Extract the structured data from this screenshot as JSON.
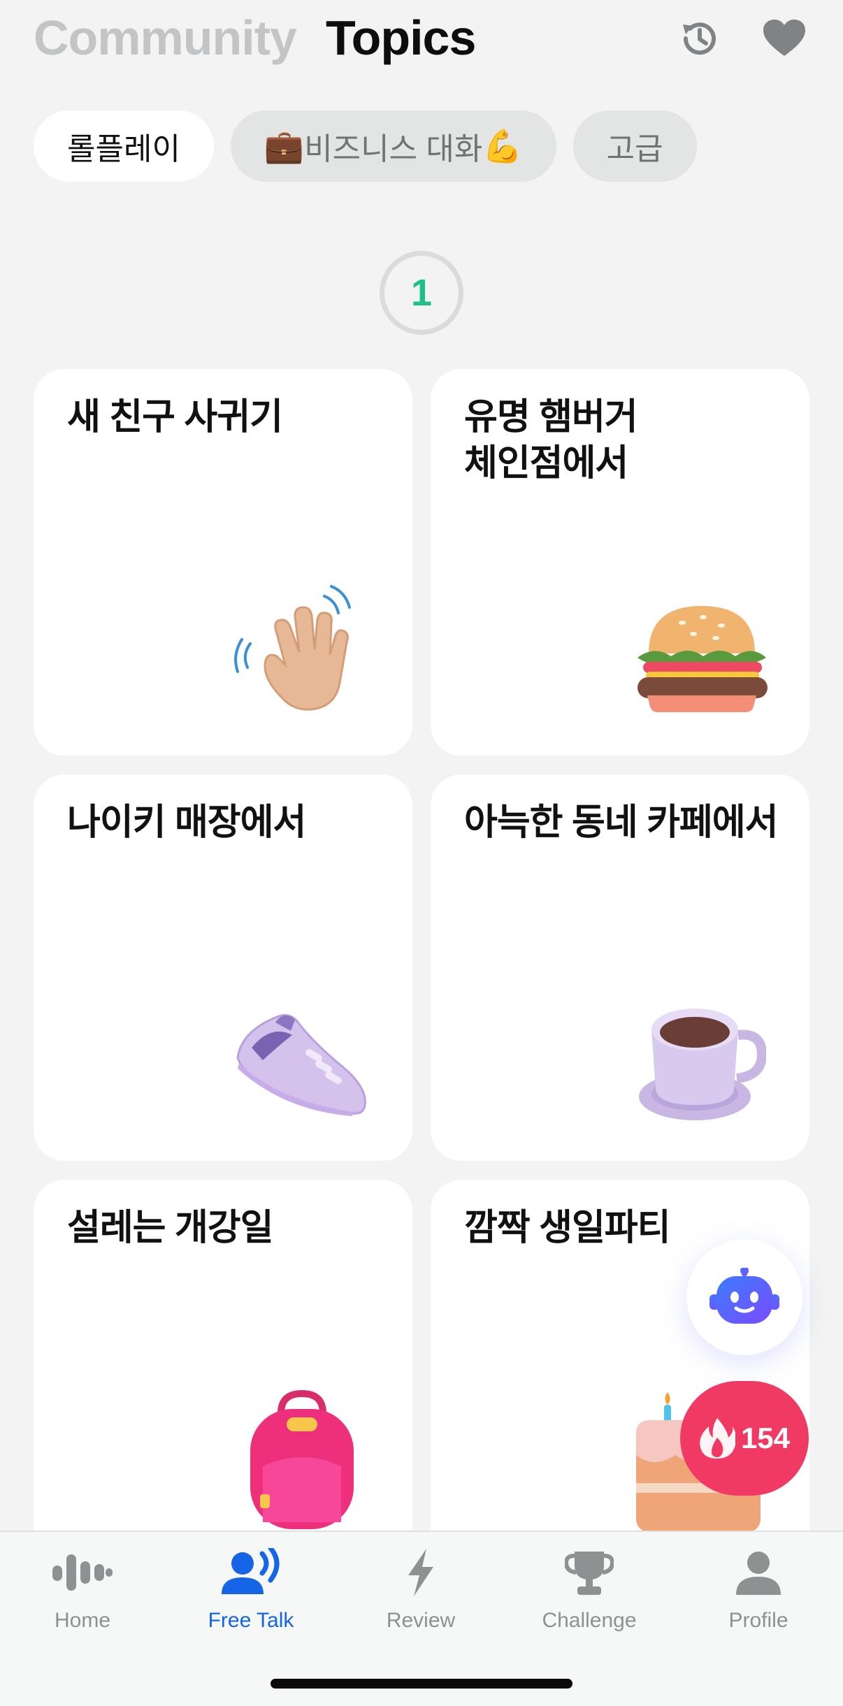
{
  "header": {
    "tabs": [
      {
        "label": "Community",
        "active": false
      },
      {
        "label": "Topics",
        "active": true
      }
    ],
    "icons": [
      "history-icon",
      "heart-icon"
    ]
  },
  "chips": [
    {
      "label": "롤플레이",
      "active": true
    },
    {
      "emoji_left": "💼",
      "label": "비즈니스 대화",
      "emoji_right": "💪",
      "active": false
    },
    {
      "label": "고급",
      "active": false
    }
  ],
  "step": {
    "number": "1",
    "color": "#1fbf89"
  },
  "cards": [
    {
      "title": "새 친구 사귀기",
      "icon": "waving-hand-icon"
    },
    {
      "title": "유명 햄버거\n체인점에서",
      "icon": "hamburger-icon"
    },
    {
      "title": "나이키 매장에서",
      "icon": "sneaker-icon"
    },
    {
      "title": "아늑한 동네 카페에서",
      "icon": "coffee-cup-icon"
    },
    {
      "title": "설레는 개강일",
      "icon": "backpack-icon"
    },
    {
      "title": "깜짝 생일파티",
      "icon": "birthday-cake-icon"
    }
  ],
  "fab": {
    "bot_icon": "robot-icon",
    "streak_count": "154",
    "streak_icon": "fire-icon",
    "streak_color": "#f13a63"
  },
  "tabbar": {
    "items": [
      {
        "label": "Home",
        "icon": "waveform-icon",
        "active": false
      },
      {
        "label": "Free Talk",
        "icon": "speaking-person-icon",
        "active": true
      },
      {
        "label": "Review",
        "icon": "lightning-icon",
        "active": false
      },
      {
        "label": "Challenge",
        "icon": "trophy-icon",
        "active": false
      },
      {
        "label": "Profile",
        "icon": "person-icon",
        "active": false
      }
    ],
    "active_color": "#1565e6"
  }
}
